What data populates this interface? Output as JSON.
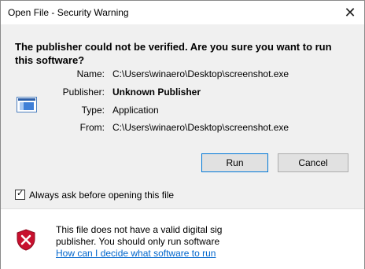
{
  "window": {
    "title": "Open File - Security Warning"
  },
  "warning": {
    "heading": "The publisher could not be verified.  Are you sure you want to run this software?"
  },
  "details": [
    {
      "label": "Name:",
      "value": "C:\\Users\\winaero\\Desktop\\screenshot.exe",
      "bold": false
    },
    {
      "label": "Publisher:",
      "value": "Unknown Publisher",
      "bold": true
    },
    {
      "label": "Type:",
      "value": "Application",
      "bold": false
    },
    {
      "label": "From:",
      "value": "C:\\Users\\winaero\\Desktop\\screenshot.exe",
      "bold": false
    }
  ],
  "buttons": {
    "run": "Run",
    "cancel": "Cancel"
  },
  "checkbox": {
    "label": "Always ask before opening this file",
    "checked": true
  },
  "notice": {
    "line1": "This file does not have a valid digital sig",
    "line2": "publisher.  You should only run software",
    "link": "How can I decide what software to run"
  },
  "icons": {
    "close": "close-icon",
    "app": "application-window-icon",
    "shield": "security-shield-icon",
    "check": "checkmark-icon"
  },
  "colors": {
    "accent": "#0078d7",
    "link": "#0066cc",
    "shield_red": "#c8102e",
    "panel": "#f0f0f0"
  }
}
